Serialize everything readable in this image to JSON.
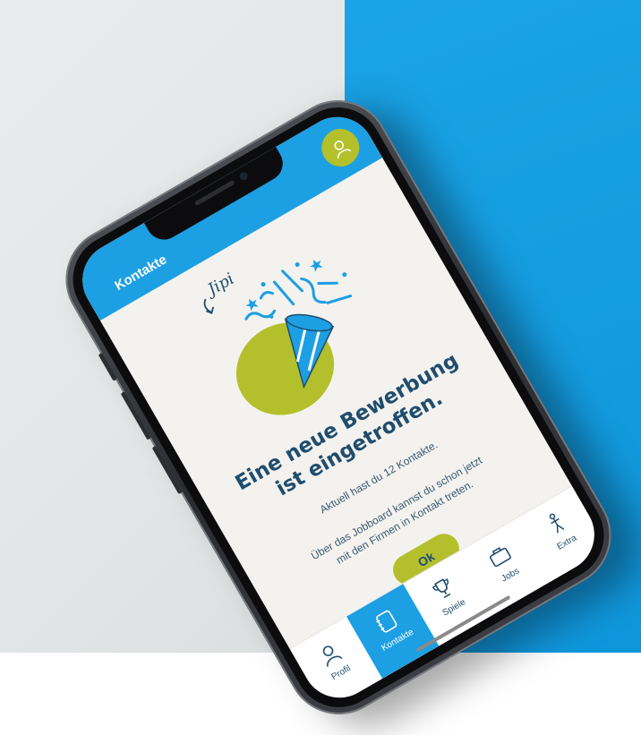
{
  "app": {
    "title": "Kontakte"
  },
  "illustration": {
    "caption": "Jipi"
  },
  "dialog": {
    "headline_line1": "Eine neue Bewerbung",
    "headline_line2": "ist eingetroffen.",
    "info": "Aktuell hast du 12 Kontakte.",
    "hint_line1": "Über das Jobboard kannst du schon jetzt",
    "hint_line2": "mit den Firmen in Kontakt treten.",
    "ok_label": "Ok"
  },
  "tabs": [
    {
      "label": "Profil",
      "icon": "person-icon",
      "active": false
    },
    {
      "label": "Kontakte",
      "icon": "contacts-icon",
      "active": true
    },
    {
      "label": "Spiele",
      "icon": "trophy-icon",
      "active": false
    },
    {
      "label": "Jobs",
      "icon": "briefcase-icon",
      "active": false
    },
    {
      "label": "Extra",
      "icon": "figure-icon",
      "active": false
    }
  ],
  "colors": {
    "accent_blue": "#1d9fe3",
    "accent_green": "#b4c02b",
    "text_dark_blue": "#1f4d6e",
    "screen_bg": "#f4f2ee"
  }
}
